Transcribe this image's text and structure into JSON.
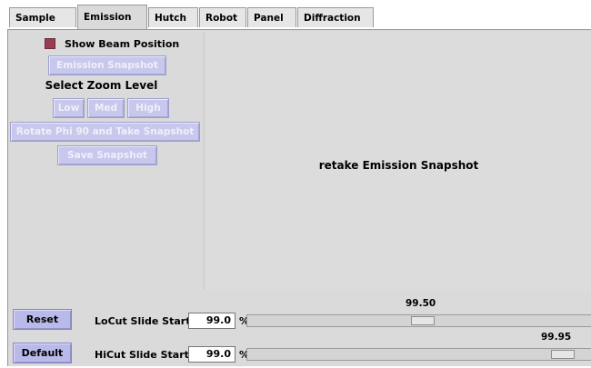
{
  "tabs": [
    {
      "label": "Sample",
      "active": false
    },
    {
      "label": "Emission",
      "active": true
    },
    {
      "label": "Hutch",
      "active": false
    },
    {
      "label": "Robot",
      "active": false
    },
    {
      "label": "Panel",
      "active": false
    },
    {
      "label": "Diffraction",
      "active": false
    }
  ],
  "controls": {
    "show_beam_position_label": "Show Beam Position",
    "show_beam_position_checked": true,
    "emission_snapshot_label": "Emission Snapshot",
    "zoom_title": "Select Zoom Level",
    "zoom_low_label": "Low",
    "zoom_med_label": "Med",
    "zoom_high_label": "High",
    "rotate_label": "Rotate Phi 90 and Take Snapshot",
    "save_label": "Save Snapshot"
  },
  "image_area": {
    "message": "retake Emission Snapshot"
  },
  "sliders": {
    "reset_label": "Reset",
    "default_label": "Default",
    "locut": {
      "label": "LoCut Slide Start:",
      "input_value": "99.0",
      "unit": "%",
      "slider_value": "99.50",
      "level": 0.51
    },
    "hicut": {
      "label": "HiCut Slide Start:",
      "input_value": "99.0",
      "unit": "%",
      "slider_value": "99.95",
      "level": 0.95
    }
  },
  "colors": {
    "button_disabled": "#c8c8ec",
    "button_active": "#b9b9ea",
    "checkbox_checked": "#9b3a55",
    "panel_bg": "#dadada"
  }
}
